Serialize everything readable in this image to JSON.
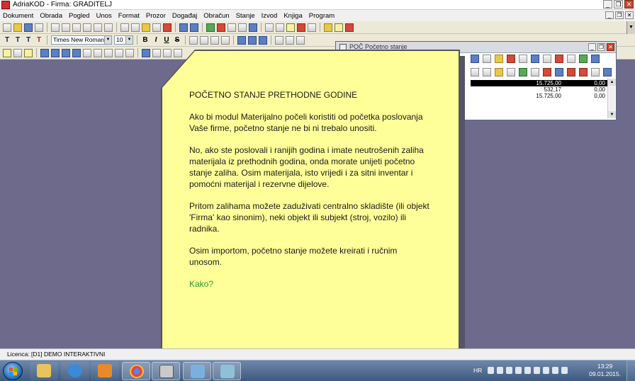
{
  "window": {
    "title": "AdriaKOD - Firma: GRADITELJ",
    "controls": [
      "_",
      "❐",
      "✕"
    ]
  },
  "menu": [
    "Dokument",
    "Obrada",
    "Pogled",
    "Unos",
    "Format",
    "Prozor",
    "Događaj",
    "Obračun",
    "Stanje",
    "Izvod",
    "Knjiga",
    "Program"
  ],
  "format_toolbar": {
    "text_styles": [
      "T",
      "T",
      "T",
      "T"
    ],
    "font_name": "Times New Roman",
    "font_size": "10",
    "style_buttons": [
      "B",
      "I",
      "U",
      "S"
    ]
  },
  "child_window": {
    "title": "POČ Početno stanje",
    "rows": [
      {
        "a": "15.725,00",
        "b": "0,00"
      },
      {
        "a": "532,17",
        "b": "0,00"
      },
      {
        "a": "15.725,00",
        "b": "0,00"
      }
    ]
  },
  "note": {
    "title": "POČETNO STANJE PRETHODNE GODINE",
    "paragraphs": [
      "Ako bi modul Materijalno počeli koristiti od početka poslovanja Vaše firme, početno stanje ne bi ni trebalo unositi.",
      "No, ako ste poslovali i ranijih godina i imate neutrošenih zaliha materijala iz prethodnih godina, onda morate unijeti početno stanje zaliha. Osim materijala, isto vrijedi i za sitni inventar i pomoćni materijal i rezervne dijelove.",
      "Pritom zalihama možete zaduživati centralno skladište (ili objekt 'Firma' kao sinonim), neki objekt ili subjekt (stroj, vozilo) ili radnika.",
      "Osim importom, početno stanje možete kreirati i ručnim unosom."
    ],
    "link": "Kako?",
    "link_color": "#2e9a2e",
    "background": "#ffff99"
  },
  "status": {
    "license": "Licenca:  [D1] DEMO INTERAKTIVNI"
  },
  "taskbar": {
    "language": "HR",
    "time": "13:29",
    "date": "09.01.2015."
  }
}
